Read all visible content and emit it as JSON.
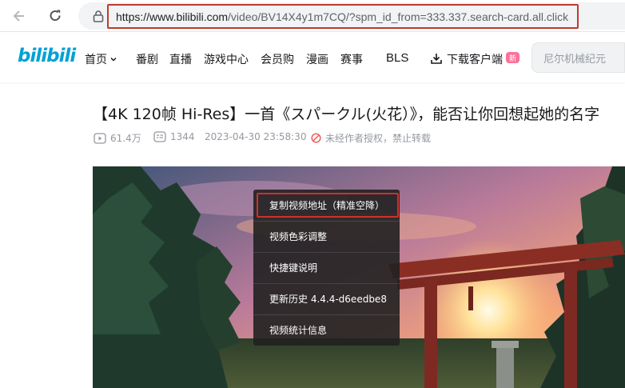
{
  "browser": {
    "url_host": "https://www.bilibili.com",
    "url_path": "/video/BV14X4y1m7CQ/?spm_id_from=333.337.search-card.all.click"
  },
  "header": {
    "logo": "bilibili",
    "nav": [
      "首页",
      "番剧",
      "直播",
      "游戏中心",
      "会员购",
      "漫画",
      "赛事",
      "BLS"
    ],
    "download": "下载客户端",
    "new_badge": "新",
    "search_placeholder": "尼尔机械纪元"
  },
  "video": {
    "title": "【4K 120帧 Hi-Res】一首《スパークル(火花）》，能否让你回想起她的名字",
    "views": "61.4万",
    "danmaku": "1344",
    "date": "2023-04-30 23:58:30",
    "copyright": "未经作者授权，禁止转载"
  },
  "context_menu": {
    "items": [
      "复制视频地址（精准空降）",
      "视频色彩调整",
      "快捷键说明",
      "更新历史 4.4.4-d6eedbe8",
      "视频统计信息"
    ]
  },
  "colors": {
    "brand": "#00a1d6",
    "highlight_border": "#c0392b",
    "badge": "#fb7299"
  }
}
